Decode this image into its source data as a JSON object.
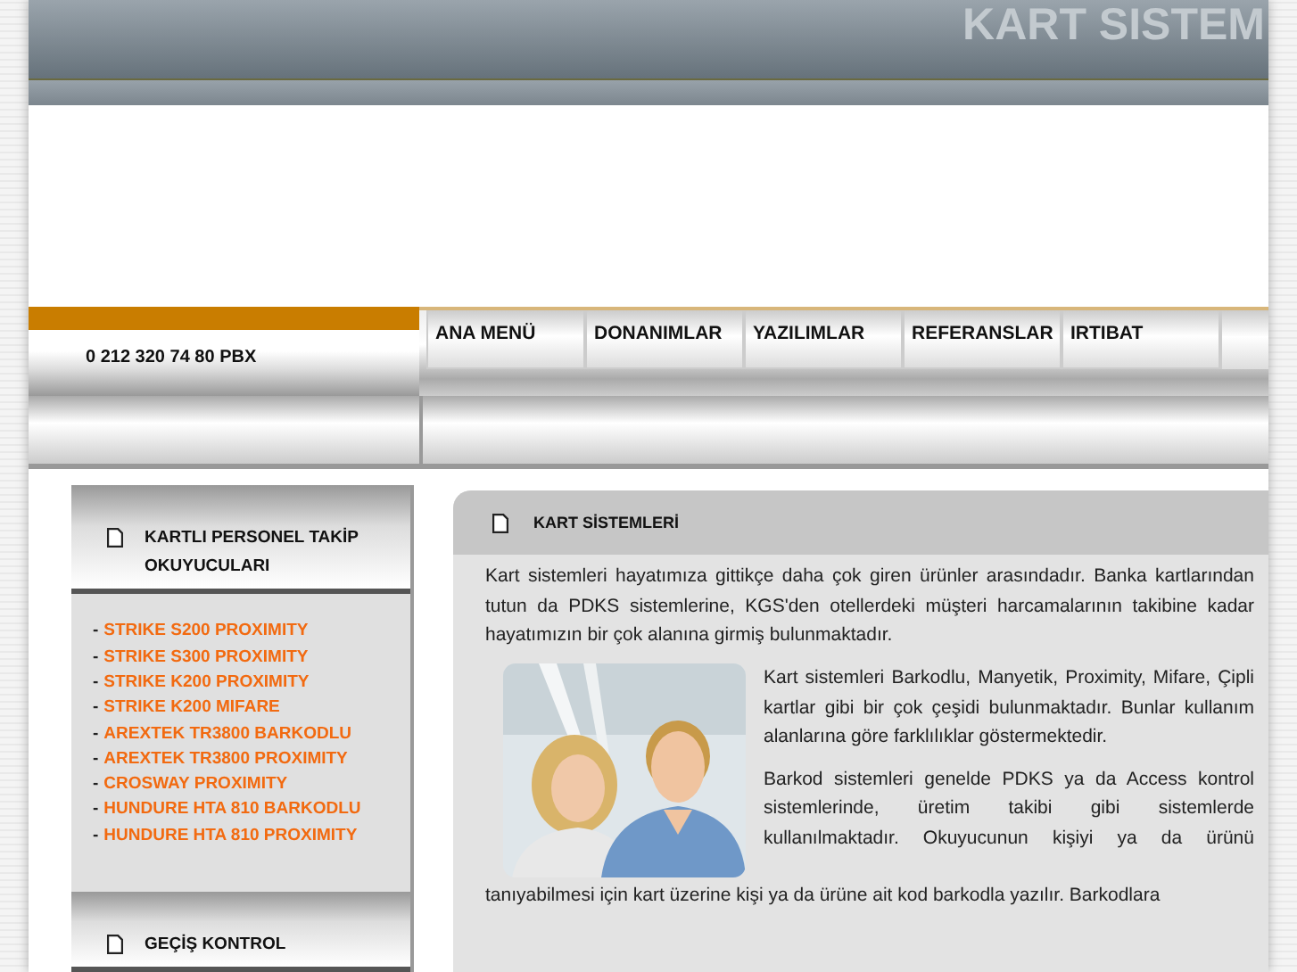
{
  "header": {
    "title": "KART SISTEM"
  },
  "phone": "0 212 320 74 80 PBX",
  "nav": [
    {
      "label": "ANA MENÜ"
    },
    {
      "label": "DONANIMLAR"
    },
    {
      "label": "YAZILIMLAR"
    },
    {
      "label": "REFERANSLAR"
    },
    {
      "label": "IRTIBAT"
    }
  ],
  "sidebar": {
    "sections": [
      {
        "title": "KARTLI PERSONEL TAKİP OKUYUCULARI",
        "items": [
          {
            "marker": "-",
            "label": "STRIKE S200 PROXIMITY"
          },
          {
            "marker": "-",
            "label": "STRIKE S300 PROXIMITY"
          },
          {
            "marker": "-",
            "label": "STRIKE K200 PROXIMITY"
          },
          {
            "marker": "-",
            "label": "STRIKE K200 MIFARE"
          },
          {
            "marker": "-",
            "label": "AREXTEK TR3800 BARKODLU"
          },
          {
            "marker": "-",
            "label": "AREXTEK TR3800 PROXIMITY"
          },
          {
            "marker": "-",
            "label": "CROSWAY PROXIMITY"
          },
          {
            "marker": "-",
            "label": "HUNDURE HTA 810 BARKODLU"
          },
          {
            "marker": "-",
            "label": "HUNDURE HTA 810 PROXIMITY"
          }
        ]
      },
      {
        "title": "GEÇİŞ KONTROL"
      }
    ]
  },
  "content": {
    "title": "KART SİSTEMLERİ",
    "intro": "Kart sistemleri hayatımıza gittikçe daha çok giren ürünler arasındadır. Banka kartlarından tutun da PDKS sistemlerine, KGS'den otellerdeki müşteri harcamalarının takibine kadar hayatımızın bir çok alanına girmiş bulunmaktadır.",
    "side_paragraphs": [
      "Kart sistemleri Barkodlu, Manyetik, Proximity, Mifare, Çipli kartlar gibi bir çok çeşidi bulunmaktadır. Bunlar kullanım alanlarına göre farklılıklar göstermektedir.",
      "Barkod sistemleri genelde PDKS ya da Access kontrol sistemlerinde, üretim takibi gibi sistemlerde kullanılmaktadır. Okuyucunun kişiyi ya da ürünü"
    ],
    "continuation": "tanıyabilmesi için kart üzerine kişi ya da ürüne ait kod barkodla yazılır. Barkodlara"
  }
}
